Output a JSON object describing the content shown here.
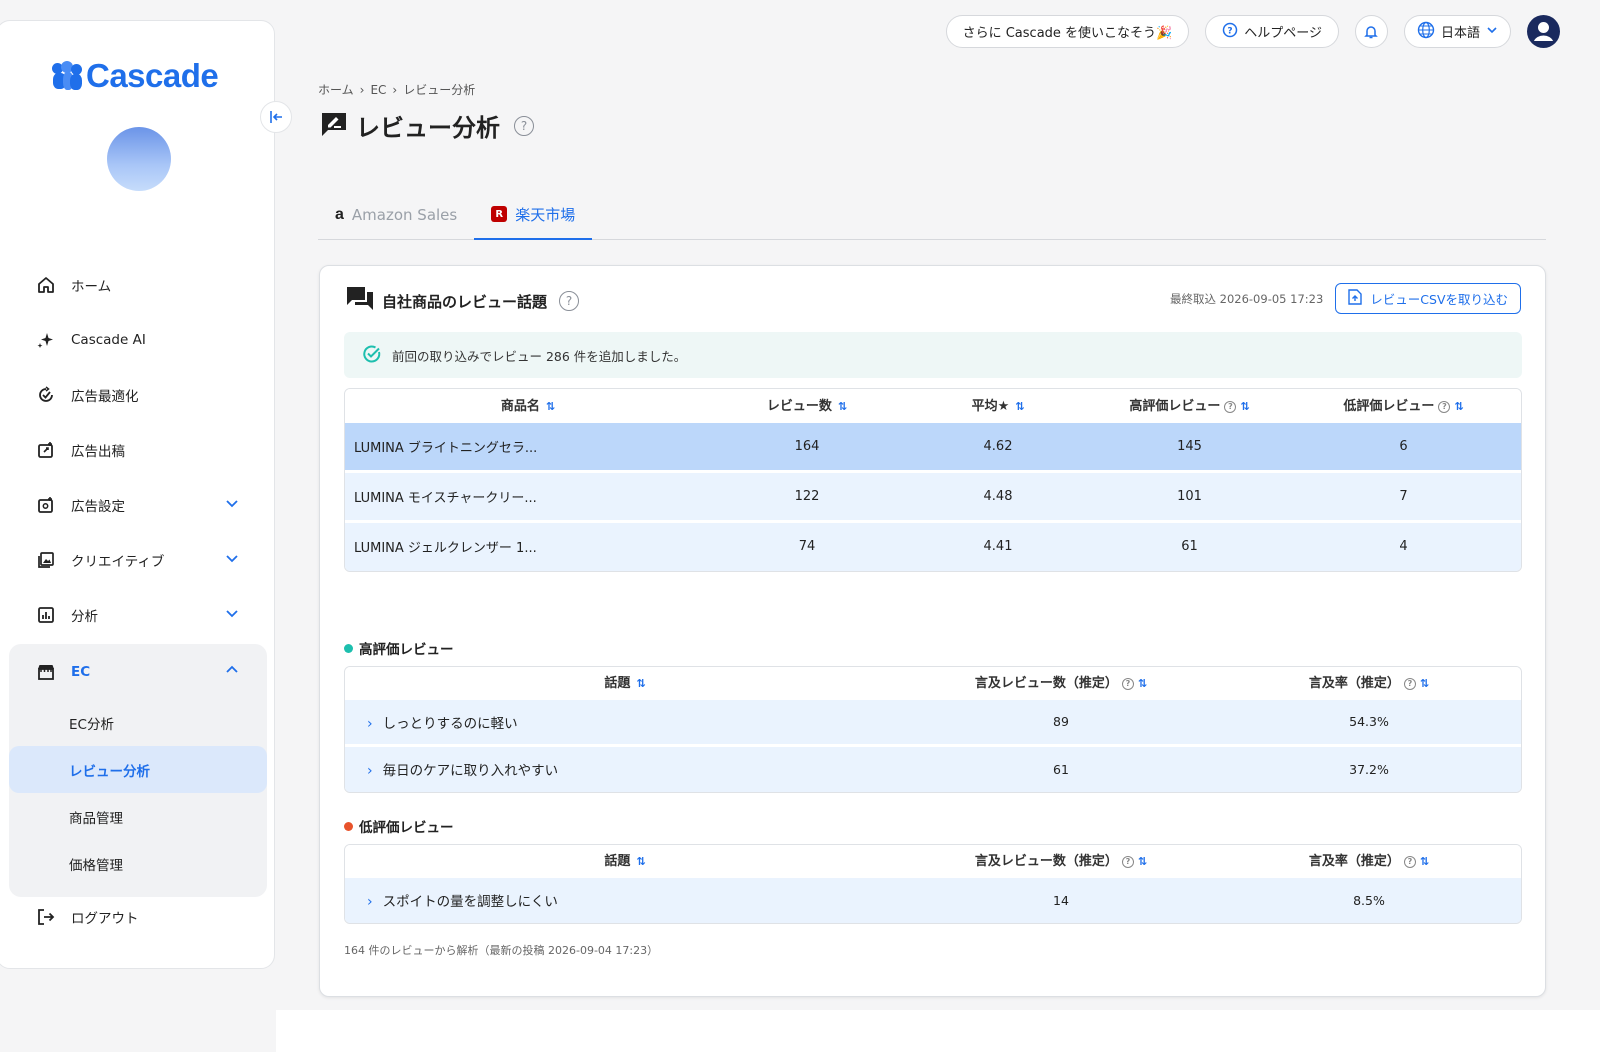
{
  "app": {
    "name": "Cascade"
  },
  "topbar": {
    "promo": "さらに Cascade を使いこなそう🎉",
    "help": "ヘルプページ",
    "language": "日本語"
  },
  "sidebar": {
    "items": [
      {
        "label": "ホーム",
        "icon": "home-icon"
      },
      {
        "label": "Cascade AI",
        "icon": "sparkle-icon"
      },
      {
        "label": "広告最適化",
        "icon": "optimize-icon"
      },
      {
        "label": "広告出稿",
        "icon": "publish-icon"
      },
      {
        "label": "広告設定",
        "icon": "settings-icon"
      },
      {
        "label": "クリエイティブ",
        "icon": "image-icon"
      },
      {
        "label": "分析",
        "icon": "chart-icon"
      }
    ],
    "ec": {
      "label": "EC",
      "sub": [
        "EC分析",
        "レビュー分析",
        "商品管理",
        "価格管理"
      ]
    },
    "logout": "ログアウト"
  },
  "breadcrumb": [
    "ホーム",
    "EC",
    "レビュー分析"
  ],
  "page_title": "レビュー分析",
  "tabs": [
    {
      "label": "Amazon Sales",
      "icon": "a"
    },
    {
      "label": "楽天市場",
      "icon": "R"
    }
  ],
  "card": {
    "title": "自社商品のレビュー話題",
    "last_import": "最終取込 2026-09-05 17:23",
    "csv_button": "レビューCSVを取り込む",
    "notice": "前回の取り込みでレビュー 286 件を追加しました。",
    "product_table": {
      "headers": [
        "商品名",
        "レビュー数",
        "平均★",
        "高評価レビュー",
        "低評価レビュー"
      ],
      "rows": [
        [
          "LUMINA ブライトニングセラ...",
          "164",
          "4.62",
          "145",
          "6"
        ],
        [
          "LUMINA モイスチャークリー...",
          "122",
          "4.48",
          "101",
          "7"
        ],
        [
          "LUMINA ジェルクレンザー 1...",
          "74",
          "4.41",
          "61",
          "4"
        ]
      ]
    },
    "positive": {
      "label": "高評価レビュー",
      "color": "#1dbfae",
      "headers": [
        "話題",
        "言及レビュー数（推定）",
        "言及率（推定）"
      ],
      "rows": [
        [
          "しっとりするのに軽い",
          "89",
          "54.3%"
        ],
        [
          "毎日のケアに取り入れやすい",
          "61",
          "37.2%"
        ]
      ]
    },
    "negative": {
      "label": "低評価レビュー",
      "color": "#e8532b",
      "headers": [
        "話題",
        "言及レビュー数（推定）",
        "言及率（推定）"
      ],
      "rows": [
        [
          "スポイトの量を調整しにくい",
          "14",
          "8.5%"
        ]
      ]
    },
    "footnote": "164 件のレビューから解析（最新の投稿 2026-09-04 17:23）"
  }
}
